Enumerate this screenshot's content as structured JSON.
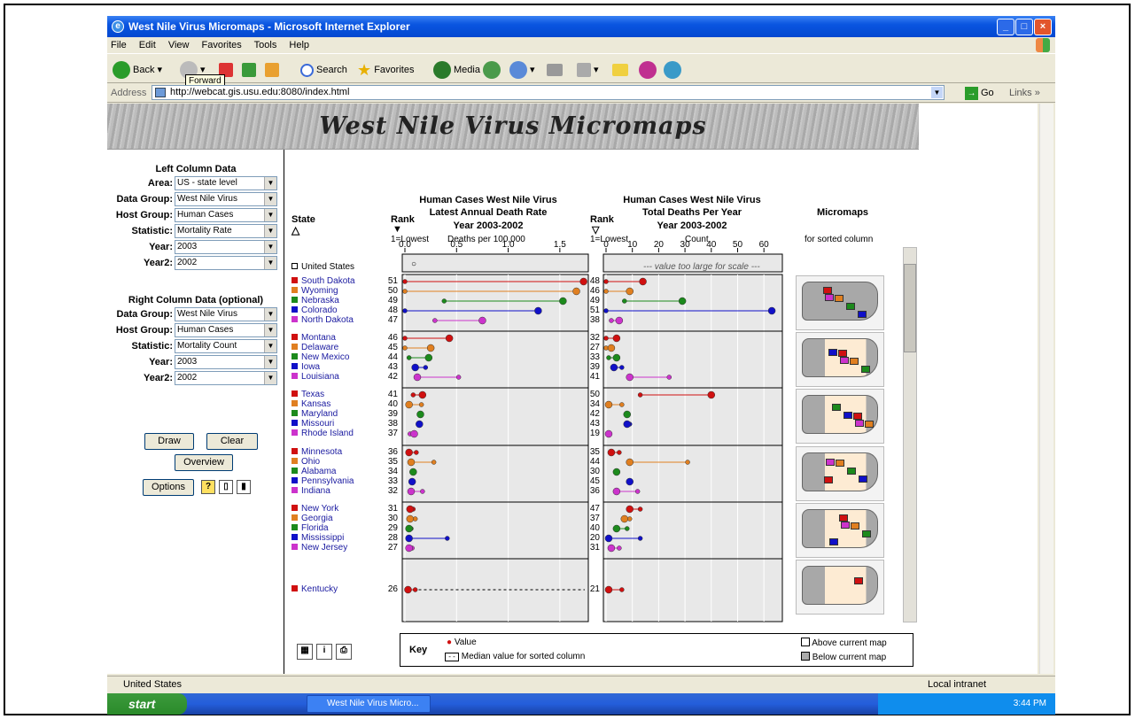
{
  "window": {
    "title": "West Nile Virus Micromaps - Microsoft Internet Explorer"
  },
  "menu": [
    "File",
    "Edit",
    "View",
    "Favorites",
    "Tools",
    "Help"
  ],
  "toolbar": {
    "back": "Back",
    "search": "Search",
    "favorites": "Favorites",
    "media": "Media",
    "tooltip": "Forward"
  },
  "address": {
    "label": "Address",
    "url": "http://webcat.gis.usu.edu:8080/index.html",
    "go": "Go",
    "links": "Links"
  },
  "banner": "West Nile Virus Micromaps",
  "left_panel": {
    "title": "Left Column Data",
    "fields": [
      {
        "label": "Area:",
        "value": "US - state level"
      },
      {
        "label": "Data Group:",
        "value": "West Nile Virus"
      },
      {
        "label": "Host Group:",
        "value": "Human Cases"
      },
      {
        "label": "Statistic:",
        "value": "Mortality Rate"
      },
      {
        "label": "Year:",
        "value": "2003"
      },
      {
        "label": "Year2:",
        "value": "2002"
      }
    ]
  },
  "right_panel": {
    "title": "Right Column Data (optional)",
    "fields": [
      {
        "label": "Data Group:",
        "value": "West Nile Virus"
      },
      {
        "label": "Host Group:",
        "value": "Human Cases"
      },
      {
        "label": "Statistic:",
        "value": "Mortality Count"
      },
      {
        "label": "Year:",
        "value": "2003"
      },
      {
        "label": "Year2:",
        "value": "2002"
      }
    ]
  },
  "buttons": {
    "draw": "Draw",
    "clear": "Clear",
    "overview": "Overview",
    "options": "Options"
  },
  "headers": {
    "state": "State",
    "rank": "Rank",
    "rank_lowest": "1=Lowest",
    "left_title1": "Human Cases West Nile Virus",
    "left_title2": "Latest Annual Death Rate",
    "left_title3": "Year 2003-2002",
    "left_unit": "Deaths per 100,000",
    "right_title1": "Human Cases West Nile Virus",
    "right_title2": "Total Deaths Per Year",
    "right_title3": "Year 2003-2002",
    "right_unit": "Count",
    "micromaps": "Micromaps",
    "micromaps_sub": "for sorted column",
    "us": "United States",
    "too_large": "--- value too large for scale ---"
  },
  "key": {
    "title": "Key",
    "value": "Value",
    "median": "Median value for sorted column",
    "above": "Above current map",
    "below": "Below current map"
  },
  "colors": {
    "red": "#d01010",
    "orange": "#e07f20",
    "green": "#1c8a1c",
    "blue": "#1010c8",
    "magenta": "#cc33cc"
  },
  "chart_data": [
    {
      "type": "dot",
      "title": "Human Cases West Nile Virus Latest Annual Death Rate Year 2003-2002",
      "xlabel": "Deaths per 100,000",
      "xlim": [
        0,
        1.75
      ],
      "ticks": [
        0.0,
        0.5,
        1.0,
        1.5
      ],
      "tick_labels": [
        "0.0",
        "0.5",
        "1.0",
        "1.5"
      ],
      "rows": [
        {
          "state": "South Dakota",
          "rank": 51,
          "v2003": 1.73,
          "v2002": 0.0
        },
        {
          "state": "Wyoming",
          "rank": 50,
          "v2003": 1.66,
          "v2002": 0.0
        },
        {
          "state": "Nebraska",
          "rank": 49,
          "v2003": 1.53,
          "v2002": 0.38
        },
        {
          "state": "Colorado",
          "rank": 48,
          "v2003": 1.29,
          "v2002": 0.0
        },
        {
          "state": "North Dakota",
          "rank": 47,
          "v2003": 0.75,
          "v2002": 0.29
        },
        {
          "state": "Montana",
          "rank": 46,
          "v2003": 0.43,
          "v2002": 0.0
        },
        {
          "state": "Delaware",
          "rank": 45,
          "v2003": 0.25,
          "v2002": 0.0
        },
        {
          "state": "New Mexico",
          "rank": 44,
          "v2003": 0.23,
          "v2002": 0.04
        },
        {
          "state": "Iowa",
          "rank": 43,
          "v2003": 0.1,
          "v2002": 0.2
        },
        {
          "state": "Louisiana",
          "rank": 42,
          "v2003": 0.12,
          "v2002": 0.52
        },
        {
          "state": "Texas",
          "rank": 41,
          "v2003": 0.17,
          "v2002": 0.08
        },
        {
          "state": "Kansas",
          "rank": 40,
          "v2003": 0.04,
          "v2002": 0.16
        },
        {
          "state": "Maryland",
          "rank": 39,
          "v2003": 0.15,
          "v2002": 0.15
        },
        {
          "state": "Missouri",
          "rank": 38,
          "v2003": 0.14,
          "v2002": 0.15
        },
        {
          "state": "Rhode Island",
          "rank": 37,
          "v2003": 0.09,
          "v2002": 0.05
        },
        {
          "state": "Minnesota",
          "rank": 36,
          "v2003": 0.04,
          "v2002": 0.11
        },
        {
          "state": "Ohio",
          "rank": 35,
          "v2003": 0.06,
          "v2002": 0.28
        },
        {
          "state": "Alabama",
          "rank": 34,
          "v2003": 0.08,
          "v2002": 0.08
        },
        {
          "state": "Pennsylvania",
          "rank": 33,
          "v2003": 0.07,
          "v2002": 0.07
        },
        {
          "state": "Indiana",
          "rank": 32,
          "v2003": 0.06,
          "v2002": 0.17
        },
        {
          "state": "New York",
          "rank": 31,
          "v2003": 0.05,
          "v2002": 0.08
        },
        {
          "state": "Georgia",
          "rank": 30,
          "v2003": 0.05,
          "v2002": 0.1
        },
        {
          "state": "Florida",
          "rank": 29,
          "v2003": 0.04,
          "v2002": 0.06
        },
        {
          "state": "Mississippi",
          "rank": 28,
          "v2003": 0.04,
          "v2002": 0.41
        },
        {
          "state": "New Jersey",
          "rank": 27,
          "v2003": 0.04,
          "v2002": 0.07
        },
        {
          "state": "Kentucky",
          "rank": 26,
          "v2003": 0.03,
          "v2002": 0.1
        }
      ]
    },
    {
      "type": "dot",
      "title": "Human Cases West Nile Virus Total Deaths Per Year Year 2003-2002",
      "xlabel": "Count",
      "xlim": [
        0,
        66
      ],
      "ticks": [
        0,
        10,
        20,
        30,
        40,
        50,
        60
      ],
      "tick_labels": [
        "0",
        "10",
        "20",
        "30",
        "40",
        "50",
        "60"
      ],
      "rows": [
        {
          "state": "South Dakota",
          "rank": 48,
          "v2003": 14,
          "v2002": 0
        },
        {
          "state": "Wyoming",
          "rank": 46,
          "v2003": 9,
          "v2002": 0
        },
        {
          "state": "Nebraska",
          "rank": 49,
          "v2003": 29,
          "v2002": 7
        },
        {
          "state": "Colorado",
          "rank": 51,
          "v2003": 63,
          "v2002": 0
        },
        {
          "state": "North Dakota",
          "rank": 38,
          "v2003": 5,
          "v2002": 2
        },
        {
          "state": "Montana",
          "rank": 32,
          "v2003": 4,
          "v2002": 0
        },
        {
          "state": "Delaware",
          "rank": 27,
          "v2003": 2,
          "v2002": 0
        },
        {
          "state": "New Mexico",
          "rank": 33,
          "v2003": 4,
          "v2002": 1
        },
        {
          "state": "Iowa",
          "rank": 39,
          "v2003": 3,
          "v2002": 6
        },
        {
          "state": "Louisiana",
          "rank": 41,
          "v2003": 9,
          "v2002": 24
        },
        {
          "state": "Texas",
          "rank": 50,
          "v2003": 40,
          "v2002": 13
        },
        {
          "state": "Kansas",
          "rank": 34,
          "v2003": 1,
          "v2002": 6
        },
        {
          "state": "Maryland",
          "rank": 42,
          "v2003": 8,
          "v2002": 8
        },
        {
          "state": "Missouri",
          "rank": 43,
          "v2003": 8,
          "v2002": 9
        },
        {
          "state": "Rhode Island",
          "rank": 19,
          "v2003": 1,
          "v2002": 1
        },
        {
          "state": "Minnesota",
          "rank": 35,
          "v2003": 2,
          "v2002": 5
        },
        {
          "state": "Ohio",
          "rank": 44,
          "v2003": 9,
          "v2002": 31
        },
        {
          "state": "Alabama",
          "rank": 30,
          "v2003": 4,
          "v2002": 4
        },
        {
          "state": "Pennsylvania",
          "rank": 45,
          "v2003": 9,
          "v2002": 9
        },
        {
          "state": "Indiana",
          "rank": 36,
          "v2003": 4,
          "v2002": 12
        },
        {
          "state": "New York",
          "rank": 47,
          "v2003": 9,
          "v2002": 13
        },
        {
          "state": "Georgia",
          "rank": 37,
          "v2003": 7,
          "v2002": 9
        },
        {
          "state": "Florida",
          "rank": 40,
          "v2003": 4,
          "v2002": 8
        },
        {
          "state": "Mississippi",
          "rank": 20,
          "v2003": 1,
          "v2002": 13
        },
        {
          "state": "New Jersey",
          "rank": 31,
          "v2003": 2,
          "v2002": 5
        },
        {
          "state": "Kentucky",
          "rank": 21,
          "v2003": 1,
          "v2002": 6
        }
      ]
    }
  ],
  "status": {
    "text": "United States",
    "zone": "Local intranet"
  },
  "taskbar": {
    "start": "start",
    "task": "West Nile Virus Micro...",
    "clock": "3:44 PM"
  }
}
